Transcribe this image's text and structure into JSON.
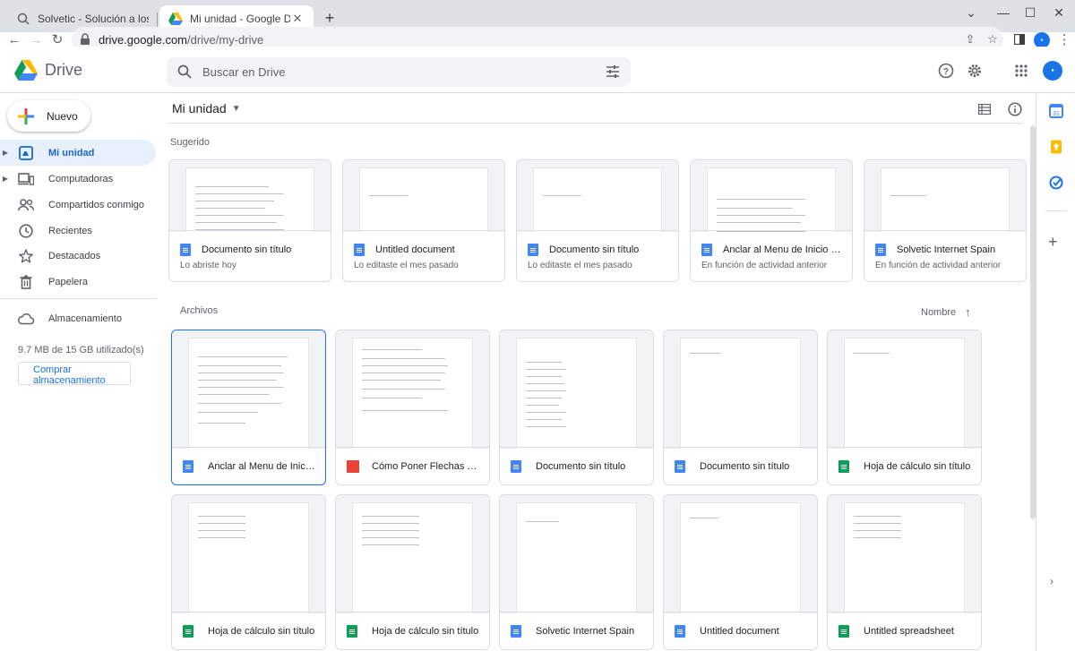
{
  "browser": {
    "tabs": [
      {
        "title": "Solvetic - Solución a los problem"
      },
      {
        "title": "Mi unidad - Google Drive"
      }
    ],
    "url_host": "drive.google.com",
    "url_path": "/drive/my-drive"
  },
  "header": {
    "product_name": "Drive",
    "search_placeholder": "Buscar en Drive"
  },
  "sidebar": {
    "new_label": "Nuevo",
    "items": [
      {
        "label": "Mi unidad"
      },
      {
        "label": "Computadoras"
      },
      {
        "label": "Compartidos conmigo"
      },
      {
        "label": "Recientes"
      },
      {
        "label": "Destacados"
      },
      {
        "label": "Papelera"
      },
      {
        "label": "Almacenamiento"
      }
    ],
    "storage_usage": "9.7 MB de 15 GB utilizado(s)",
    "buy_storage_label": "Comprar almacenamiento"
  },
  "main": {
    "location": "Mi unidad",
    "suggested_title": "Sugerido",
    "files_title": "Archivos",
    "sort_label": "Nombre",
    "suggested": [
      {
        "title": "Documento sin título",
        "subtitle": "Lo abriste hoy",
        "type": "doc"
      },
      {
        "title": "Untitled document",
        "subtitle": "Lo editaste el mes pasado",
        "type": "doc"
      },
      {
        "title": "Documento sin título",
        "subtitle": "Lo editaste el mes pasado",
        "type": "doc"
      },
      {
        "title": "Anclar al Menu de Inicio Windo...",
        "subtitle": "En función de actividad anterior",
        "type": "doc"
      },
      {
        "title": "Solvetic Internet Spain",
        "subtitle": "En función de actividad anterior",
        "type": "doc"
      }
    ],
    "files": [
      {
        "title": "Anclar al Menu de Inicio Wi...",
        "type": "doc"
      },
      {
        "title": "Cómo Poner Flechas en Ex...",
        "type": "pdf"
      },
      {
        "title": "Documento sin título",
        "type": "doc"
      },
      {
        "title": "Documento sin título",
        "type": "doc"
      },
      {
        "title": "Hoja de cálculo sin título",
        "type": "sheet"
      },
      {
        "title": "Hoja de cálculo sin título",
        "type": "sheet"
      },
      {
        "title": "Hoja de cálculo sin título",
        "type": "sheet"
      },
      {
        "title": "Solvetic Internet Spain",
        "type": "doc"
      },
      {
        "title": "Untitled document",
        "type": "doc"
      },
      {
        "title": "Untitled spreadsheet",
        "type": "sheet"
      }
    ]
  },
  "colors": {
    "accent": "#1a73e8",
    "nav_active_bg": "#e8f0fe",
    "doc": "#4285f4",
    "sheet": "#0f9d58",
    "pdf": "#ea4335"
  }
}
